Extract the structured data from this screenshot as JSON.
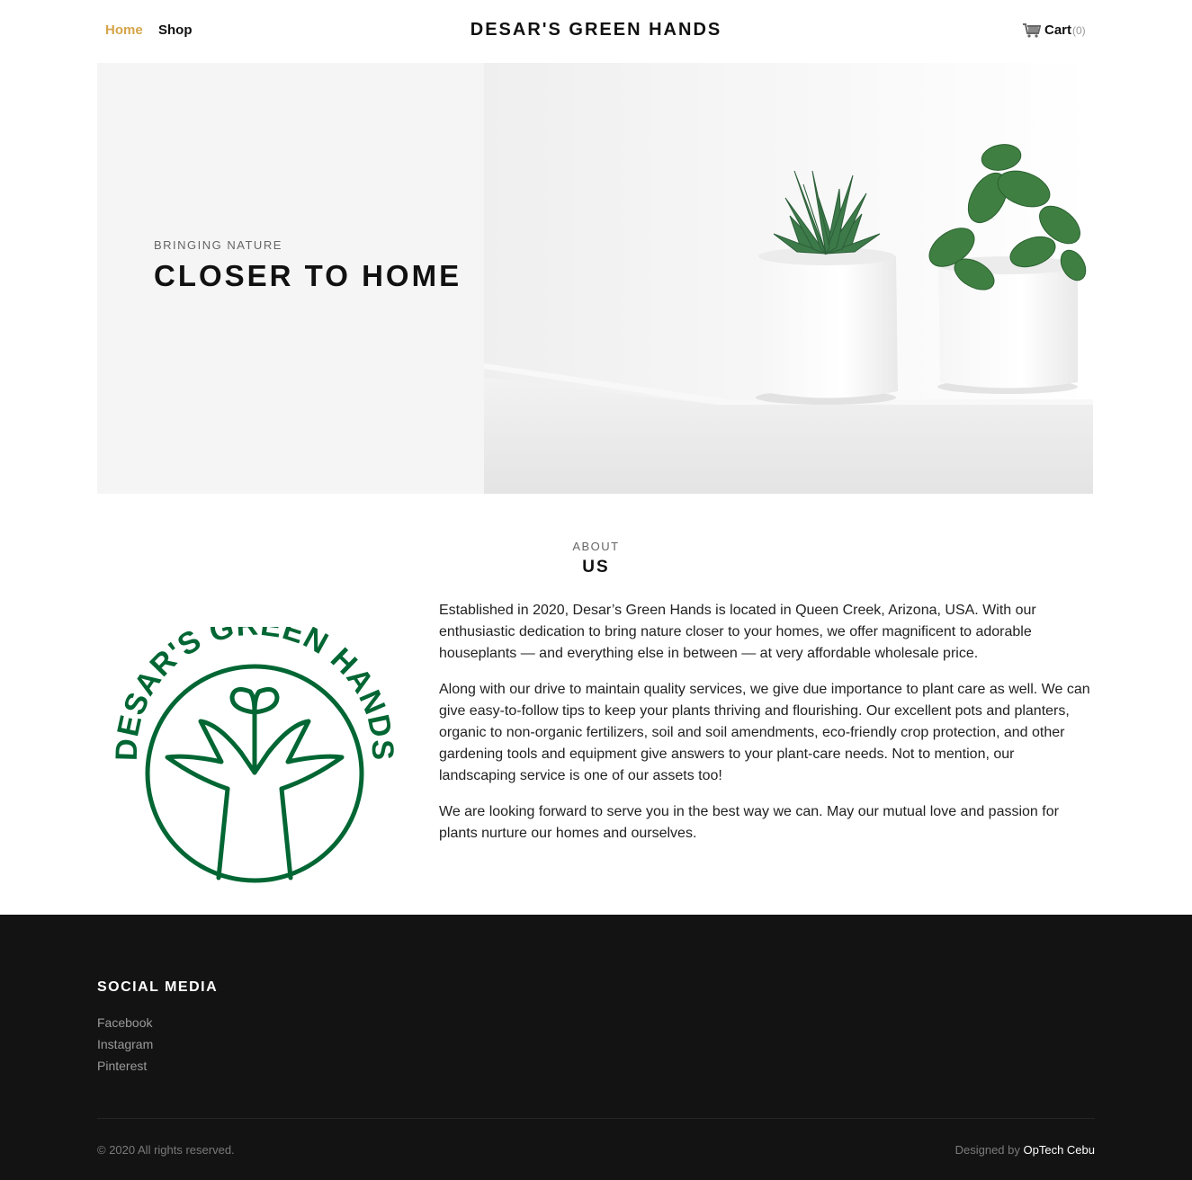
{
  "nav": {
    "home_label": "Home",
    "shop_label": "Shop",
    "brand": "DESAR'S GREEN HANDS",
    "cart_label": "Cart",
    "cart_count": "(0)",
    "cart_icon": "cart-icon"
  },
  "hero": {
    "subtitle": "BRINGING NATURE",
    "title": "CLOSER TO HOME",
    "image": "two-succulents-in-white-pots"
  },
  "about": {
    "kicker": "ABOUT",
    "title": "US",
    "logo_text": "DESAR'S GREEN HANDS",
    "paragraphs": [
      "Established in 2020, Desar’s Green Hands is located in Queen Creek, Arizona, USA. With our enthusiastic dedication to bring nature closer to your homes, we offer magnificent to adorable houseplants — and everything else in between — at very affordable wholesale price.",
      "Along with our drive to maintain quality services, we give due importance to plant care as well. We can give easy-to-follow tips to keep your plants thriving and flourishing. Our excellent pots and planters, organic to non-organic fertilizers, soil and soil amendments, eco-friendly crop protection, and other gardening tools and equipment give answers to your plant-care needs. Not to mention, our landscaping service is one of our assets too!",
      "We are looking forward to serve you in the best way we can. May our mutual love and passion for plants nurture our homes and ourselves."
    ]
  },
  "footer": {
    "heading": "SOCIAL MEDIA",
    "links": [
      "Facebook",
      "Instagram",
      "Pinterest"
    ],
    "copyright": "© 2020 All rights reserved.",
    "designed_by_prefix": "Designed by ",
    "designed_by_name": "OpTech Cebu"
  },
  "colors": {
    "accent": "#d6a54a",
    "logo_green": "#006633",
    "footer_bg": "#131313"
  }
}
